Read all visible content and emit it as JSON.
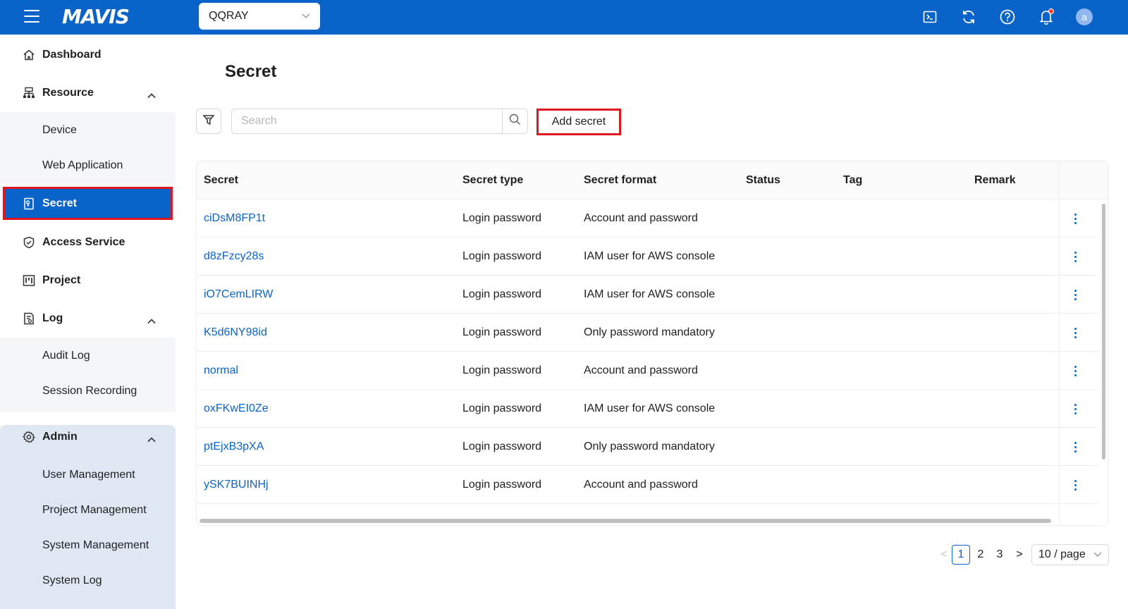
{
  "header": {
    "logo": "MAVIS",
    "project": "QQRAY",
    "avatar_letter": "a",
    "accent_color": "#0a63c9",
    "icons": [
      "terminal-icon",
      "refresh-icon",
      "help-icon",
      "bell-icon"
    ]
  },
  "sidebar": {
    "dashboard": "Dashboard",
    "resource": "Resource",
    "device": "Device",
    "web_application": "Web Application",
    "secret": "Secret",
    "access_service": "Access Service",
    "project": "Project",
    "log": "Log",
    "audit_log": "Audit Log",
    "session_recording": "Session Recording",
    "admin": "Admin",
    "user_management": "User Management",
    "project_management": "Project Management",
    "system_management": "System Management",
    "system_log": "System Log"
  },
  "main": {
    "title": "Secret",
    "search_placeholder": "Search",
    "add_button": "Add secret"
  },
  "table": {
    "columns": [
      "Secret",
      "Secret type",
      "Secret format",
      "Status",
      "Tag",
      "Remark"
    ],
    "rows": [
      {
        "secret": "ciDsM8FP1t",
        "type": "Login password",
        "format": "Account and password"
      },
      {
        "secret": "d8zFzcy28s",
        "type": "Login password",
        "format": "IAM user for AWS console"
      },
      {
        "secret": "iO7CemLIRW",
        "type": "Login password",
        "format": "IAM user for AWS console"
      },
      {
        "secret": "K5d6NY98id",
        "type": "Login password",
        "format": "Only password mandatory"
      },
      {
        "secret": "normal",
        "type": "Login password",
        "format": "Account and password"
      },
      {
        "secret": "oxFKwEI0Ze",
        "type": "Login password",
        "format": "IAM user for AWS console"
      },
      {
        "secret": "ptEjxB3pXA",
        "type": "Login password",
        "format": "Only password mandatory"
      },
      {
        "secret": "ySK7BUINHj",
        "type": "Login password",
        "format": "Account and password"
      }
    ]
  },
  "pagination": {
    "prev": "<",
    "pages": [
      "1",
      "2",
      "3"
    ],
    "current": "1",
    "next": ">",
    "page_size": "10 / page"
  }
}
